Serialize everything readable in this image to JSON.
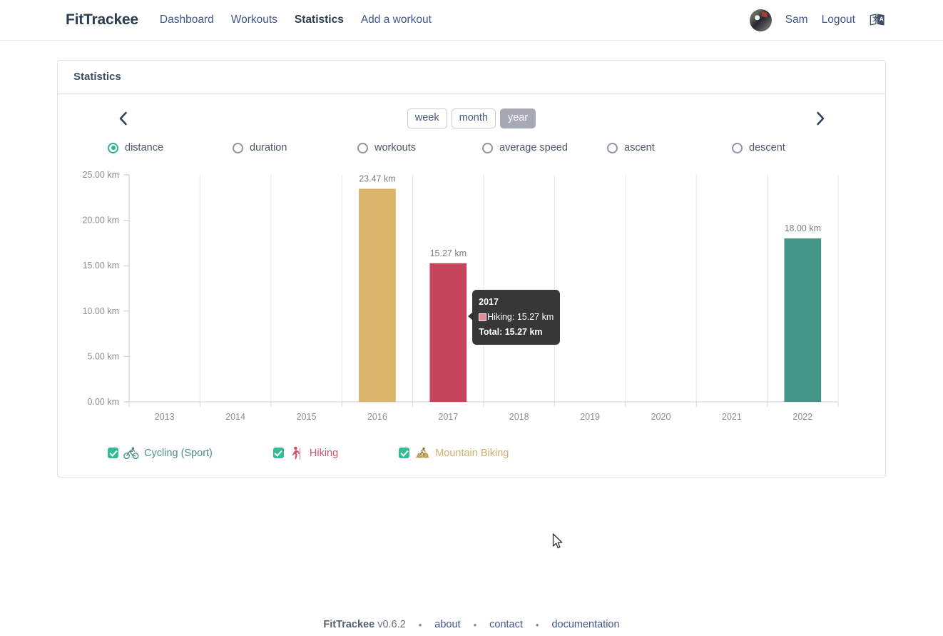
{
  "header": {
    "brand": "FitTrackee",
    "nav": [
      {
        "label": "Dashboard",
        "active": false
      },
      {
        "label": "Workouts",
        "active": false
      },
      {
        "label": "Statistics",
        "active": true
      },
      {
        "label": "Add a workout",
        "active": false
      }
    ],
    "user_name": "Sam",
    "logout_label": "Logout",
    "avatar_icon": "user-avatar",
    "language_icon": "language-switch-icon"
  },
  "card": {
    "title": "Statistics"
  },
  "controls": {
    "prev_icon": "chevron-left-icon",
    "next_icon": "chevron-right-icon",
    "timeframes": [
      {
        "label": "week",
        "active": false
      },
      {
        "label": "month",
        "active": false
      },
      {
        "label": "year",
        "active": true
      }
    ],
    "metrics": [
      {
        "label": "distance",
        "checked": true
      },
      {
        "label": "duration",
        "checked": false
      },
      {
        "label": "workouts",
        "checked": false
      },
      {
        "label": "average speed",
        "checked": false
      },
      {
        "label": "ascent",
        "checked": false
      },
      {
        "label": "descent",
        "checked": false
      }
    ]
  },
  "chart_data": {
    "type": "bar",
    "title": "",
    "xlabel": "",
    "ylabel": "",
    "unit": "km",
    "categories": [
      "2013",
      "2014",
      "2015",
      "2016",
      "2017",
      "2018",
      "2019",
      "2020",
      "2021",
      "2022"
    ],
    "ylim": [
      0,
      25
    ],
    "yticks": [
      0,
      5,
      10,
      15,
      20,
      25
    ],
    "ytick_labels": [
      "0.00 km",
      "5.00 km",
      "10.00 km",
      "15.00 km",
      "20.00 km",
      "25.00 km"
    ],
    "grid": "vertical",
    "legend_position": "bottom",
    "series": [
      {
        "name": "Cycling (Sport)",
        "color": "#439588",
        "values": [
          0,
          0,
          0,
          0,
          0,
          0,
          0,
          0,
          0,
          18.0
        ]
      },
      {
        "name": "Hiking",
        "color": "#c4455c",
        "values": [
          0,
          0,
          0,
          0,
          15.27,
          0,
          0,
          0,
          0,
          0
        ]
      },
      {
        "name": "Mountain Biking",
        "color": "#dbb56a",
        "values": [
          0,
          0,
          0,
          23.47,
          0,
          0,
          0,
          0,
          0,
          0
        ]
      }
    ],
    "bar_labels": [
      {
        "category": "2016",
        "text": "23.47 km"
      },
      {
        "category": "2017",
        "text": "15.27 km"
      },
      {
        "category": "2022",
        "text": "18.00 km"
      }
    ]
  },
  "tooltip": {
    "title": "2017",
    "entry_label": "Hiking: 15.27 km",
    "entry_color": "#e48a99",
    "total_label": "Total: 15.27 km"
  },
  "legend": [
    {
      "label": "Cycling (Sport)",
      "color": "#439588",
      "checked": true,
      "icon": "cycling-sport-icon"
    },
    {
      "label": "Hiking",
      "color": "#c4455c",
      "checked": true,
      "icon": "hiking-icon"
    },
    {
      "label": "Mountain Biking",
      "color": "#cfae6c",
      "checked": true,
      "icon": "mountain-biking-icon"
    }
  ],
  "footer": {
    "brand": "FitTrackee",
    "version": "v0.6.2",
    "separator": "•",
    "links": [
      "about",
      "contact",
      "documentation"
    ]
  },
  "colors": {
    "accent_green": "#2eb398",
    "nav_link": "#40578a",
    "text": "#2c3e50",
    "axis": "#9a9a9a",
    "grid": "#e6e6e6"
  }
}
